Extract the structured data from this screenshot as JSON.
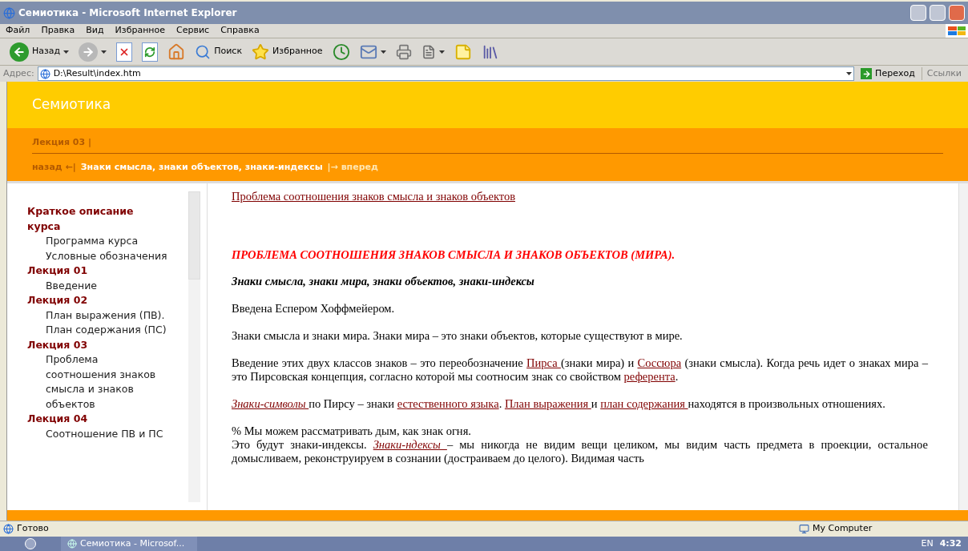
{
  "window": {
    "title": "Семиотика - Microsoft Internet Explorer"
  },
  "menu": [
    "Файл",
    "Правка",
    "Вид",
    "Избранное",
    "Сервис",
    "Справка"
  ],
  "toolbar": [
    {
      "kind": "back",
      "label": "Назад",
      "dropdown": true
    },
    {
      "kind": "forward",
      "dropdown": true
    },
    {
      "kind": "stop"
    },
    {
      "kind": "refresh"
    },
    {
      "kind": "home"
    },
    {
      "kind": "search",
      "label": "Поиск"
    },
    {
      "kind": "favorites",
      "label": "Избранное"
    },
    {
      "kind": "history"
    },
    {
      "kind": "mail",
      "dropdown": true
    },
    {
      "kind": "print"
    },
    {
      "kind": "edit",
      "dropdown": true
    },
    {
      "kind": "note"
    },
    {
      "kind": "research"
    }
  ],
  "address": {
    "label": "Адрес:",
    "value": "D:\\Result\\index.htm",
    "go": "Переход",
    "links": "Ссылки"
  },
  "site": {
    "title": "Семиотика",
    "breadcrumb": "Лекция 03 |",
    "prev": "назад ←|",
    "current": "Знаки смысла, знаки объектов, знаки-индексы",
    "next": "|→ вперед"
  },
  "sidebar": {
    "items": [
      {
        "label": "Краткое описание курса",
        "children": [
          {
            "label": "Программа курса"
          },
          {
            "label": "Условные обозначения"
          }
        ]
      },
      {
        "label": "Лекция 01",
        "children": [
          {
            "label": "Введение"
          }
        ]
      },
      {
        "label": "Лекция 02",
        "children": [
          {
            "label": "План выражения (ПВ). План содержания (ПС)"
          }
        ]
      },
      {
        "label": "Лекция 03",
        "children": [
          {
            "label": "Проблема соотношения знаков смысла и знаков объектов"
          }
        ]
      },
      {
        "label": "Лекция 04",
        "children": [
          {
            "label": "Соотношение ПВ и ПС"
          }
        ]
      }
    ]
  },
  "article": {
    "heading_link": "Проблема соотношения знаков смысла и знаков объектов",
    "title": "ПРОБЛЕМА СООТНОШЕНИЯ ЗНАКОВ СМЫСЛА И ЗНАКОВ ОБЪЕКТОВ  (МИРА).",
    "subtitle": "Знаки смысла, знаки мира, знаки объектов, знаки-индексы",
    "paragraphs": [
      [
        [
          {
            "kind": "text",
            "text": "Введена Еспером Хоффмейером."
          }
        ]
      ],
      [
        [
          {
            "kind": "text",
            "text": "Знаки смысла и знаки мира. Знаки мира – это знаки объектов, которые существуют в мире."
          }
        ]
      ],
      [
        [
          {
            "kind": "text",
            "text": "Введение этих двух классов знаков – это переобозначение "
          },
          {
            "kind": "link",
            "text": "Пирса "
          },
          {
            "kind": "text",
            "text": "(знаки мира) и "
          },
          {
            "kind": "link",
            "text": "Соссюра"
          },
          {
            "kind": "text",
            "text": " (знаки  смысла). Когда речь идет о знаках мира – это Пирсовская концепция, согласно которой мы соотносим знак со свойством "
          },
          {
            "kind": "link",
            "text": "референта"
          },
          {
            "kind": "text",
            "text": "."
          }
        ]
      ],
      [
        [
          {
            "kind": "italic_link",
            "text": "Знаки-символы "
          },
          {
            "kind": "text",
            "text": "по Пирсу – знаки "
          },
          {
            "kind": "link",
            "text": "естественного языка"
          },
          {
            "kind": "text",
            "text": ". "
          },
          {
            "kind": "link",
            "text": "План выражения "
          },
          {
            "kind": "text",
            "text": "и "
          },
          {
            "kind": "link",
            "text": "план содержания "
          },
          {
            "kind": "text",
            "text": "находятся в произвольных отношениях."
          }
        ]
      ],
      [
        [
          {
            "kind": "text",
            "text": "% Мы можем рассматривать дым, как знак огня."
          }
        ],
        [
          {
            "kind": "text",
            "text": "Это будут знаки-индексы. "
          },
          {
            "kind": "italic_link",
            "text": "Знаки-ндексы "
          },
          {
            "kind": "text",
            "text": "– мы никогда не видим вещи целиком, мы видим часть предмета в проекции, остальное домысливаем, реконструируем в сознании (достраиваем до целого). Видимая часть"
          }
        ]
      ]
    ]
  },
  "status_bar": {
    "text": "Готово",
    "zone": "My Computer"
  },
  "taskbar": {
    "task": "Семиотика - Microsof...",
    "lang": "EN",
    "clock": "4:32"
  }
}
